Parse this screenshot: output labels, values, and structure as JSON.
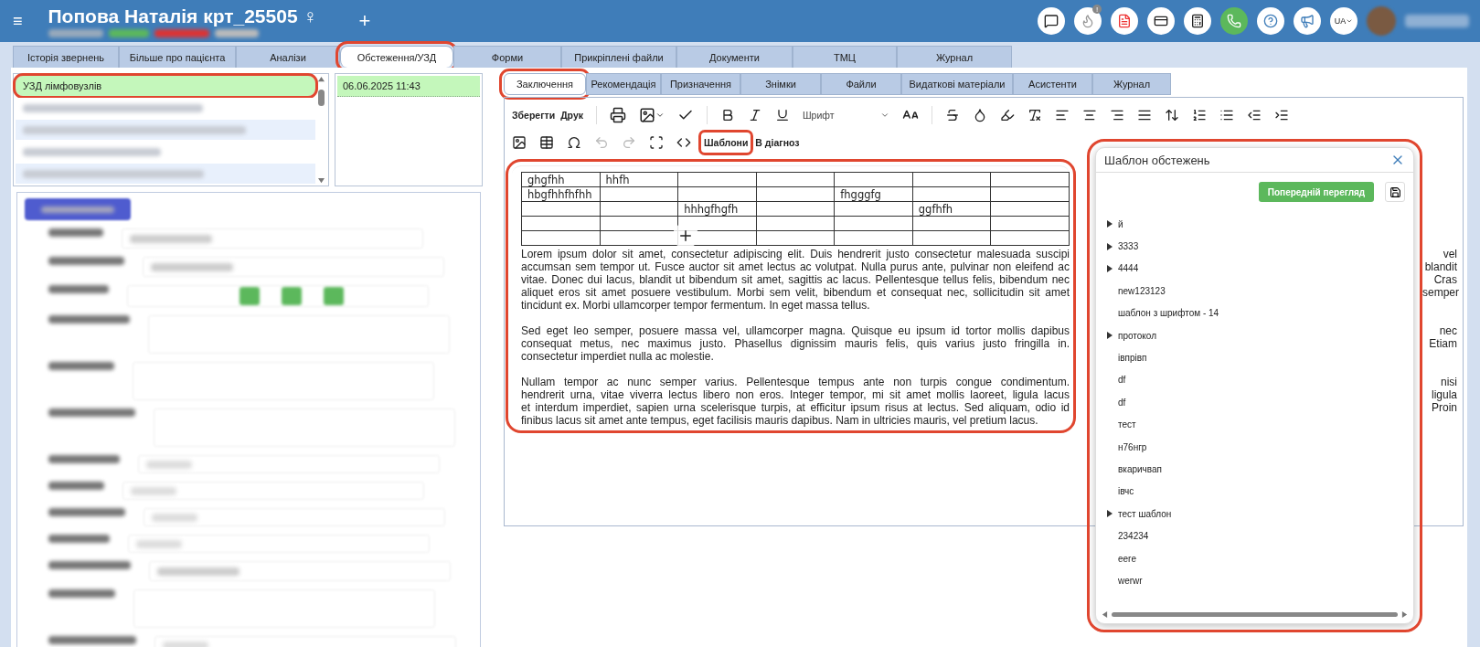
{
  "header": {
    "menu_glyph": "≡",
    "title": "Попова Наталія крт_25505 ♀",
    "add_glyph": "+",
    "language": "UA",
    "notification_badge": "!"
  },
  "main_tabs": [
    {
      "label": "Історія звернень",
      "selected": false,
      "highlighted": false
    },
    {
      "label": "Більше про пацієнта",
      "selected": false,
      "highlighted": false
    },
    {
      "label": "Аналізи",
      "selected": false,
      "highlighted": false
    },
    {
      "label": "Обстеження/УЗД",
      "selected": true,
      "highlighted": true
    },
    {
      "label": "Форми",
      "selected": false,
      "highlighted": false
    },
    {
      "label": "Прикріплені файли",
      "selected": false,
      "highlighted": false
    },
    {
      "label": "Документи",
      "selected": false,
      "highlighted": false
    },
    {
      "label": "ТМЦ",
      "selected": false,
      "highlighted": false
    },
    {
      "label": "Журнал",
      "selected": false,
      "highlighted": false
    }
  ],
  "exam_list": [
    {
      "kind": "text",
      "label": "УЗД лімфовузлів",
      "selected": true,
      "highlighted": true
    },
    {
      "kind": "redacted",
      "selected": false,
      "highlighted": false
    },
    {
      "kind": "redacted",
      "selected": false,
      "highlighted": false
    },
    {
      "kind": "redacted",
      "selected": false,
      "highlighted": false
    },
    {
      "kind": "redacted",
      "selected": false,
      "highlighted": false
    }
  ],
  "dates": [
    {
      "label": "06.06.2025 11:43",
      "selected": true
    }
  ],
  "form_rows": [
    {
      "kind": "select"
    },
    {
      "kind": "select"
    },
    {
      "kind": "buttons"
    },
    {
      "kind": "textarea"
    },
    {
      "kind": "textarea"
    },
    {
      "kind": "textarea"
    },
    {
      "kind": "input"
    },
    {
      "kind": "input"
    },
    {
      "kind": "input"
    },
    {
      "kind": "input"
    },
    {
      "kind": "select"
    },
    {
      "kind": "textarea"
    },
    {
      "kind": "input"
    }
  ],
  "editor_tabs": [
    {
      "label": "Заключення",
      "selected": true,
      "highlighted": true
    },
    {
      "label": "Рекомендація",
      "selected": false,
      "highlighted": false
    },
    {
      "label": "Призначення",
      "selected": false,
      "highlighted": false
    },
    {
      "label": "Знімки",
      "selected": false,
      "highlighted": false
    },
    {
      "label": "Файли",
      "selected": false,
      "highlighted": false
    },
    {
      "label": "Видаткові матеріали",
      "selected": false,
      "highlighted": false
    },
    {
      "label": "Асистенти",
      "selected": false,
      "highlighted": false
    },
    {
      "label": "Журнал",
      "selected": false,
      "highlighted": false
    }
  ],
  "toolbar": {
    "save": "Зберегти",
    "print": "Друк",
    "font": "Шрифт",
    "templates": {
      "label": "Шаблони",
      "highlighted": true
    },
    "to_diagnosis": "В діагноз"
  },
  "document": {
    "highlighted": true,
    "table": [
      {
        "kind": "data",
        "column_1": "ghgfhh",
        "column_2": "hhfh"
      },
      {
        "kind": "data",
        "column_1": "hbgfhhfhfhh",
        "column_5": "fhgggfg"
      },
      {
        "kind": "data",
        "column_3": "hhhgfhgfh",
        "column_6": "ggfhfh"
      },
      {
        "kind": "blank"
      },
      {
        "kind": "blank"
      }
    ],
    "paragraphs": [
      [
        {
          "left": "Lorem ipsum dolor sit amet, consectetur adipiscing elit. Duis hendrerit justo consectetur malesuada suscipi",
          "right": "vel"
        },
        {
          "left": "accumsan sem tempor ut. Fusce auctor sit amet lectus ac volutpat. Nulla purus ante, pulvinar non eleifend ac",
          "right": "blandit"
        },
        {
          "left": "vitae. Donec dui lacus, blandit ut bibendum sit amet, sagittis ac lacus. Pellentesque tellus felis, bibendum nec",
          "right": "Cras"
        },
        {
          "left": "aliquet eros sit amet posuere vestibulum. Morbi sem velit, bibendum et consequat nec, sollicitudin sit amet",
          "right": "semper"
        },
        {
          "left": "tincidunt ex. Morbi ullamcorper tempor fermentum. In eget massa tellus."
        }
      ],
      [
        {
          "left": "Sed eget leo semper, posuere massa vel, ullamcorper magna. Quisque eu ipsum id tortor mollis dapibus",
          "right": "nec"
        },
        {
          "left": "consequat metus, nec maximus justo. Phasellus dignissim mauris felis, quis varius justo fringilla in.",
          "right": "Etiam"
        },
        {
          "left": "consectetur imperdiet nulla ac molestie."
        }
      ],
      [
        {
          "left": "Nullam tempor ac nunc semper varius. Pellentesque tempus ante non turpis congue condimentum.",
          "right": "nisi"
        },
        {
          "left": "hendrerit urna, vitae viverra lectus libero non eros. Integer tempor, mi sit amet mollis laoreet, ligula lacus",
          "right": "ligula"
        },
        {
          "left": "et interdum imperdiet, sapien urna scelerisque turpis, at efficitur ipsum risus at lectus. Sed aliquam, odio id",
          "right": "Proin"
        },
        {
          "left": "finibus lacus sit amet ante tempus, eget facilisis mauris dapibus. Nam in ultricies mauris, vel pretium lacus."
        }
      ]
    ]
  },
  "template_panel": {
    "title": "Шаблон обстежень",
    "highlighted": true,
    "preview_button": "Попередній перегляд",
    "items": [
      {
        "label": "й",
        "kind": "group"
      },
      {
        "label": "3333",
        "kind": "group"
      },
      {
        "label": "4444",
        "kind": "group"
      },
      {
        "label": "new123123",
        "kind": "item"
      },
      {
        "label": "шаблон з шрифтом - 14",
        "kind": "item"
      },
      {
        "label": "протокол",
        "kind": "group"
      },
      {
        "label": "івпрівп",
        "kind": "item"
      },
      {
        "label": "df",
        "kind": "item"
      },
      {
        "label": "df",
        "kind": "item"
      },
      {
        "label": "тест",
        "kind": "item"
      },
      {
        "label": "н76нгр",
        "kind": "item"
      },
      {
        "label": "вкаричвап",
        "kind": "item"
      },
      {
        "label": "івчс",
        "kind": "item"
      },
      {
        "label": "тест шаблон",
        "kind": "group"
      },
      {
        "label": "234234",
        "kind": "item"
      },
      {
        "label": "eere",
        "kind": "item"
      },
      {
        "label": "werwr",
        "kind": "item"
      }
    ]
  }
}
